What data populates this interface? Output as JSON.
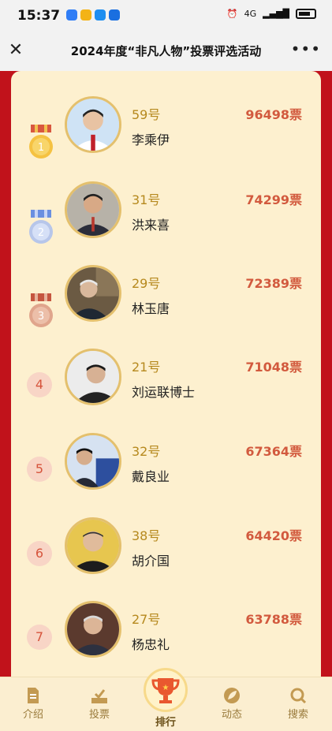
{
  "status": {
    "time": "15:37",
    "network": "4G",
    "app_icon_colors": [
      "#2f7df6",
      "#f3b316",
      "#1e8ef0",
      "#1a6fe0"
    ]
  },
  "header": {
    "title": "2024年度“非凡人物”投票评选活动",
    "close_icon": "close-icon",
    "more_icon": "more-icon"
  },
  "ranking": [
    {
      "rank": "1",
      "number": "59号",
      "name": "李乘伊",
      "votes": "96498票",
      "badge": "gold-medal-icon"
    },
    {
      "rank": "2",
      "number": "31号",
      "name": "洪来喜",
      "votes": "74299票",
      "badge": "silver-medal-icon"
    },
    {
      "rank": "3",
      "number": "29号",
      "name": "林玉唐",
      "votes": "72389票",
      "badge": "bronze-medal-icon"
    },
    {
      "rank": "4",
      "number": "21号",
      "name": "刘运联博士",
      "votes": "71048票"
    },
    {
      "rank": "5",
      "number": "32号",
      "name": "戴良业",
      "votes": "67364票"
    },
    {
      "rank": "6",
      "number": "38号",
      "name": "胡介国",
      "votes": "64420票"
    },
    {
      "rank": "7",
      "number": "27号",
      "name": "杨忠礼",
      "votes": "63788票"
    }
  ],
  "nav": {
    "intro": "介绍",
    "vote": "投票",
    "rank": "排行",
    "news": "动态",
    "search": "搜索"
  },
  "colors": {
    "background_red": "#c1121b",
    "card_cream": "#fdf0cf",
    "votes_red": "#d25a3e",
    "number_gold": "#b6891e"
  }
}
